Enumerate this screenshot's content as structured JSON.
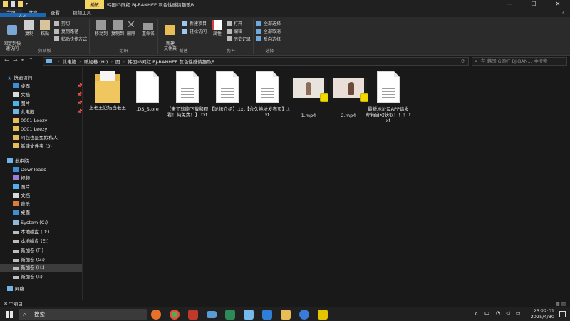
{
  "titlebar": {
    "context_tab": "播放",
    "title": "韩国IG网红 BJ-BANHEE 灰色性感情趣歌B",
    "minimize": "—",
    "maximize": "☐",
    "close": "✕"
  },
  "tabs": [
    "文件",
    "主页",
    "共享",
    "查看",
    "视频工具"
  ],
  "help": "?",
  "ribbon": {
    "clipboard": {
      "label": "剪贴板",
      "pin": "固定到快\n速访问",
      "copy": "复制",
      "paste": "粘贴",
      "cut": "剪切",
      "copy_path": "复制路径",
      "paste_shortcut": "粘贴快捷方式"
    },
    "organize": {
      "label": "组织",
      "move_to": "移动到",
      "copy_to": "复制到",
      "delete": "删除",
      "rename": "重命名"
    },
    "new": {
      "label": "新建",
      "new_folder": "新建\n文件夹",
      "new_item": "新建项目",
      "easy_access": "轻松访问"
    },
    "open": {
      "label": "打开",
      "properties": "属性",
      "open": "打开",
      "edit": "编辑",
      "history": "历史记录"
    },
    "select": {
      "label": "选择",
      "select_all": "全部选择",
      "select_none": "全部取消",
      "invert": "反向选择"
    }
  },
  "address": {
    "crumbs": [
      "此电脑",
      "新加卷 (H:)",
      "图",
      "韩国IG网红 BJ-BANHEE 灰色性感情趣歌B"
    ],
    "search_placeholder": "在 韩国IG网红 BJ-BAN... 中搜索"
  },
  "sidebar": {
    "quick_access": "快速访问",
    "quick_items": [
      "桌面",
      "文档",
      "图片",
      "此电脑",
      "0001.Leezy",
      "0001.Leezy",
      "阿包也是兔娘私人",
      "新建文件夹 (3)"
    ],
    "this_pc": "此电脑",
    "pc_items": [
      "Downloads",
      "视频",
      "图片",
      "文档",
      "音乐",
      "桌面",
      "System (C:)",
      "本地磁盘 (D:)",
      "本地磁盘 (E:)",
      "新加卷 (F:)",
      "新加卷 (G:)",
      "新加卷 (H:)",
      "新加卷 (I:)"
    ],
    "network": "网络"
  },
  "files": [
    {
      "name": "上老王论坛当老王",
      "type": "folder"
    },
    {
      "name": ".DS_Store",
      "type": "blank"
    },
    {
      "name": "【来了就能下载和观看！纯免费！】.txt",
      "type": "txt"
    },
    {
      "name": "【论坛介绍】.txt",
      "type": "txt"
    },
    {
      "name": "【永久地址发布页】.txt",
      "type": "txt"
    },
    {
      "name": "1.mp4",
      "type": "video"
    },
    {
      "name": "2.mp4",
      "type": "video"
    },
    {
      "name": "最新地址及APP请发邮箱自动获取！！！.txt",
      "type": "txt"
    }
  ],
  "status": {
    "count": "8 个项目"
  },
  "taskbar": {
    "search": "搜索",
    "lang": "中",
    "time": "23:22:01",
    "date": "2025/4/30"
  }
}
